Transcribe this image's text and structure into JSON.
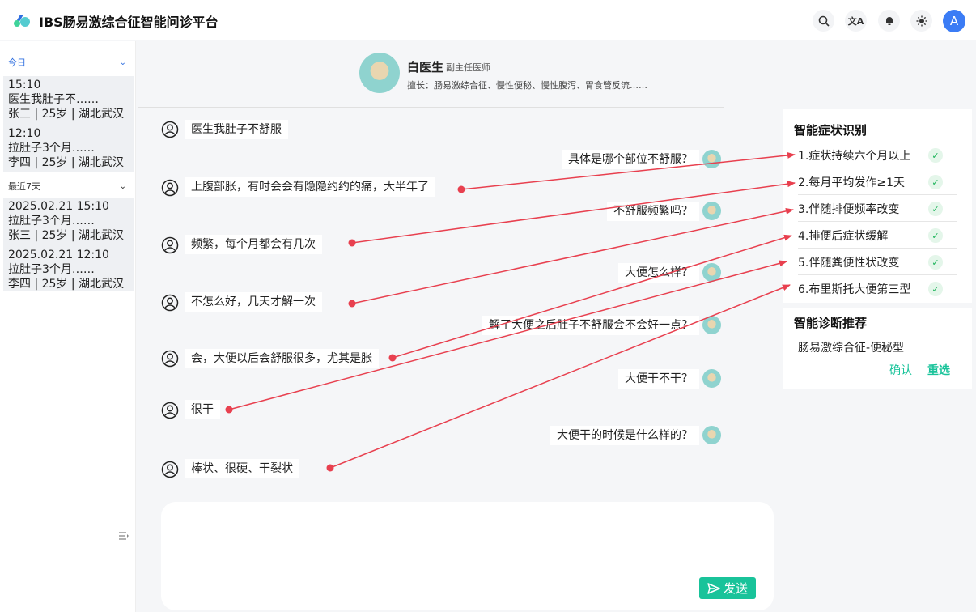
{
  "app": {
    "title": "IBS肠易激综合征智能问诊平台",
    "user_initial": "A"
  },
  "header_icons": [
    "search-icon",
    "translate-icon",
    "bell-icon",
    "sun-icon"
  ],
  "sidebar": {
    "today_label": "今日",
    "today_items": [
      {
        "time": "15:10",
        "preview": "医生我肚子不……",
        "patient": "张三 | 25岁 | 湖北武汉"
      },
      {
        "time": "12:10",
        "preview": "拉肚子3个月……",
        "patient": "李四 | 25岁 | 湖北武汉"
      }
    ],
    "week_label": "最近7天",
    "week_items": [
      {
        "time": "2025.02.21 15:10",
        "preview": "拉肚子3个月……",
        "patient": "张三 | 25岁 | 湖北武汉"
      },
      {
        "time": "2025.02.21 12:10",
        "preview": "拉肚子3个月……",
        "patient": "李四 | 25岁 | 湖北武汉"
      }
    ]
  },
  "doctor": {
    "name": "白医生",
    "title": "副主任医师",
    "specialty": "擅长：肠易激综合征、慢性便秘、慢性腹泻、胃食管反流……"
  },
  "chat": {
    "user_messages": [
      "医生我肚子不舒服",
      "上腹部胀，有时会会有隐隐约约的痛，大半年了",
      "频繁，每个月都会有几次",
      "不怎么好，几天才解一次",
      "会，大便以后会舒服很多，尤其是胀",
      "很干",
      "棒状、很硬、干裂状"
    ],
    "bot_messages": [
      "具体是哪个部位不舒服？",
      "不舒服频繁吗？",
      "大便怎么样？",
      "解了大便之后肚子不舒服会不会好一点？",
      "大便干不干？",
      "大便干的时候是什么样的？"
    ],
    "send_label": "发送"
  },
  "symptoms": {
    "title": "智能症状识别",
    "items": [
      "1.症状持续六个月以上",
      "2.每月平均发作≥1天",
      "3.伴随排便频率改变",
      "4.排便后症状缓解",
      "5.伴随粪便性状改变",
      "6.布里斯托大便第三型"
    ]
  },
  "diagnosis": {
    "title": "智能诊断推荐",
    "result": "肠易激综合征-便秘型",
    "confirm_label": "确认",
    "reselect_label": "重选"
  },
  "colors": {
    "accent": "#19c39a",
    "arrow": "#e8404f",
    "link": "#2f6fe0"
  }
}
